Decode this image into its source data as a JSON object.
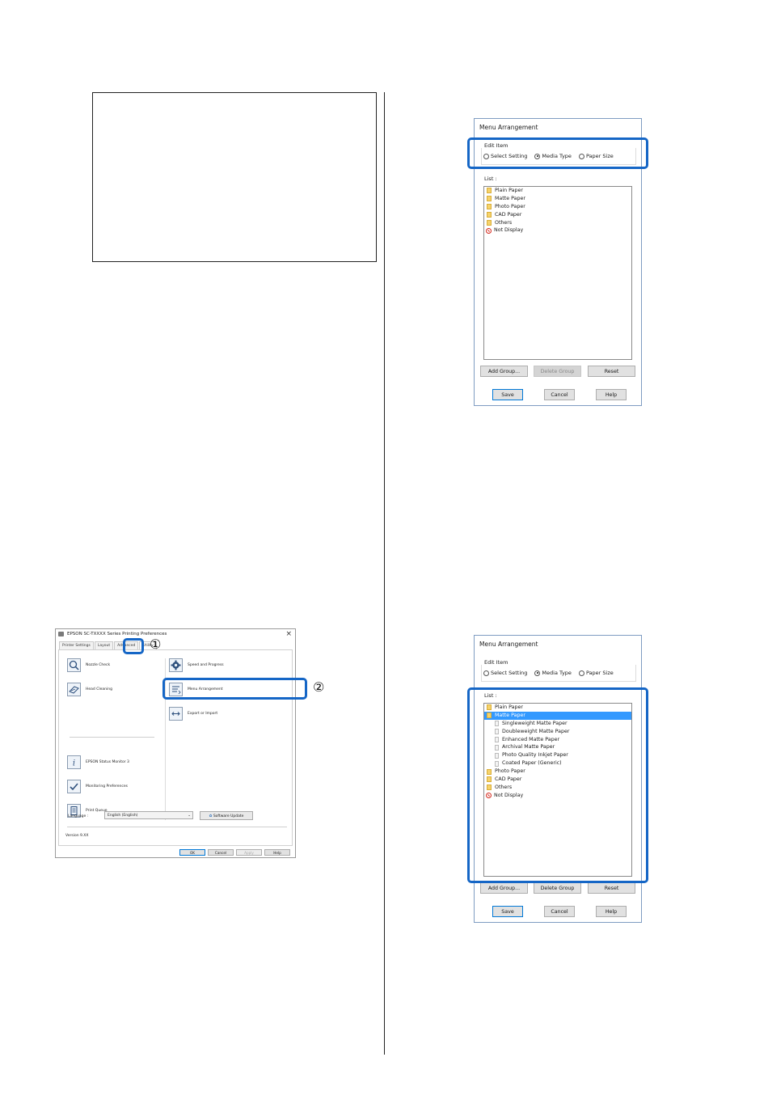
{
  "colors": {
    "callout": "#1566c6",
    "selection": "#3399ff",
    "folder": "#f6d36b",
    "not_display": "#d42a1e"
  },
  "printer_dialog": {
    "title": "EPSON SC-TXXXX Series Printing Preferences",
    "close": "×",
    "tabs": [
      "Printer Settings",
      "Layout",
      "Advanced",
      "Utility"
    ],
    "items_left": [
      {
        "label": "Nozzle Check",
        "icon": "nozzle-check-icon"
      },
      {
        "label": "Head Cleaning",
        "icon": "head-cleaning-icon"
      },
      {
        "label": "EPSON Status Monitor 3",
        "icon": "status-monitor-icon"
      },
      {
        "label": "Monitoring Preferences",
        "icon": "monitoring-preferences-icon"
      },
      {
        "label": "Print Queue",
        "icon": "print-queue-icon"
      }
    ],
    "items_right": [
      {
        "label": "Speed and Progress",
        "icon": "gear-icon"
      },
      {
        "label": "Menu Arrangement",
        "icon": "menu-arrangement-icon"
      },
      {
        "label": "Export or Import",
        "icon": "export-import-icon"
      }
    ],
    "language_label": "Language :",
    "language_value": "English (English)",
    "software_update": "Software Update",
    "version": "Version 9.XX",
    "buttons": {
      "ok": "OK",
      "cancel": "Cancel",
      "apply": "Apply",
      "help": "Help"
    },
    "callout_1": "①",
    "callout_2": "②"
  },
  "menu_dialog_1": {
    "title": "Menu Arrangement",
    "edit_item_label": "Edit Item",
    "radios": [
      "Select Setting",
      "Media Type",
      "Paper Size"
    ],
    "selected_radio": "Media Type",
    "list_label": "List :",
    "list": [
      "Plain Paper",
      "Matte Paper",
      "Photo Paper",
      "CAD Paper",
      "Others",
      "Not Display"
    ],
    "buttons": {
      "add_group": "Add Group...",
      "delete_group": "Delete Group",
      "reset": "Reset",
      "save": "Save",
      "cancel": "Cancel",
      "help": "Help"
    }
  },
  "menu_dialog_2": {
    "title": "Menu Arrangement",
    "edit_item_label": "Edit Item",
    "radios": [
      "Select Setting",
      "Media Type",
      "Paper Size"
    ],
    "selected_radio": "Media Type",
    "list_label": "List :",
    "list": [
      "Plain Paper",
      "Matte Paper",
      "Singleweight Matte Paper",
      "Doubleweight Matte Paper",
      "Enhanced Matte Paper",
      "Archival Matte Paper",
      "Photo Quality Inkjet Paper",
      "Coated Paper (Generic)",
      "Photo Paper",
      "CAD Paper",
      "Others",
      "Not Display"
    ],
    "selected_item": "Matte Paper",
    "buttons": {
      "add_group": "Add Group...",
      "delete_group": "Delete Group",
      "reset": "Reset",
      "save": "Save",
      "cancel": "Cancel",
      "help": "Help"
    }
  }
}
